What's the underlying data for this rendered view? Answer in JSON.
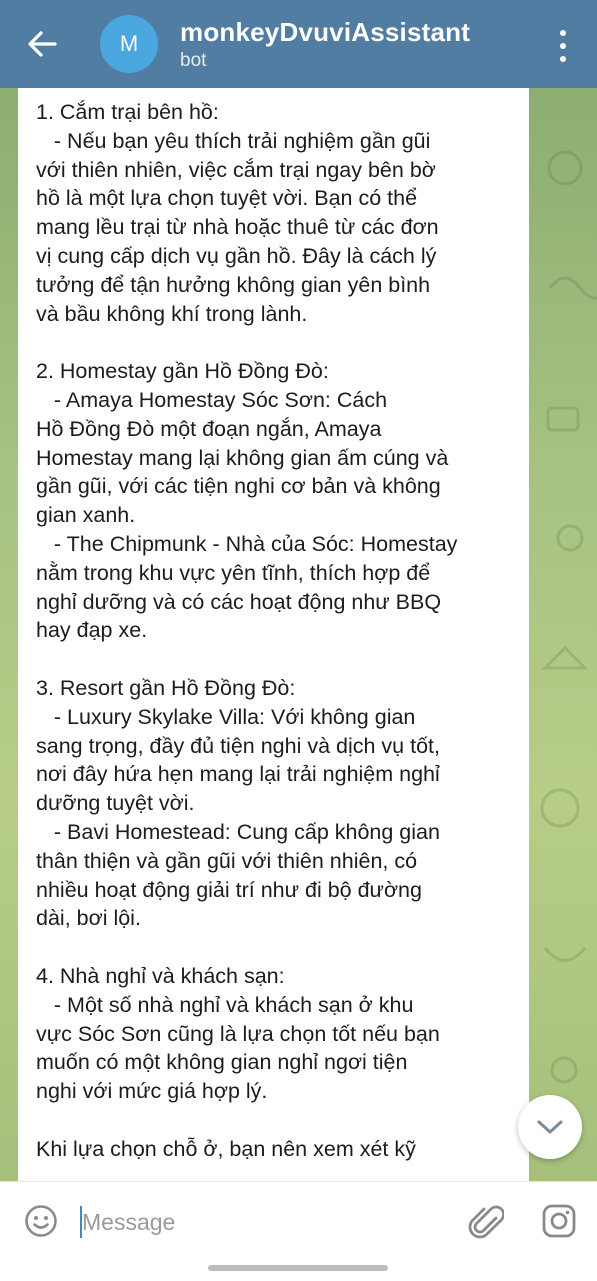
{
  "header": {
    "avatar_letter": "M",
    "title": "monkeyDvuviAssistant",
    "subtitle": "bot"
  },
  "message": {
    "text": "1. Cắm trại bên hồ:\n   - Nếu bạn yêu thích trải nghiệm gần gũi\nvới thiên nhiên, việc cắm trại ngay bên bờ\nhồ là một lựa chọn tuyệt vời. Bạn có thể\nmang lều trại từ nhà hoặc thuê từ các đơn\nvị cung cấp dịch vụ gần hồ. Đây là cách lý\ntưởng để tận hưởng không gian yên bình\nvà bầu không khí trong lành.\n\n2. Homestay gần Hồ Đồng Đò:\n   - Amaya Homestay Sóc Sơn: Cách\nHồ Đồng Đò một đoạn ngắn, Amaya\nHomestay mang lại không gian ấm cúng và\ngần gũi, với các tiện nghi cơ bản và không\ngian xanh.\n   - The Chipmunk - Nhà của Sóc: Homestay\nnằm trong khu vực yên tĩnh, thích hợp để\nnghỉ dưỡng và có các hoạt động như BBQ\nhay đạp xe.\n\n3. Resort gần Hồ Đồng Đò:\n   - Luxury Skylake Villa: Với không gian\nsang trọng, đầy đủ tiện nghi và dịch vụ tốt,\nnơi đây hứa hẹn mang lại trải nghiệm nghỉ\ndưỡng tuyệt vời.\n   - Bavi Homestead: Cung cấp không gian\nthân thiện và gần gũi với thiên nhiên, có\nnhiều hoạt động giải trí như đi bộ đường\ndài, bơi lội.\n\n4. Nhà nghỉ và khách sạn:\n   - Một số nhà nghỉ và khách sạn ở khu\nvực Sóc Sơn cũng là lựa chọn tốt nếu bạn\nmuốn có một không gian nghỉ ngơi tiện\nnghi với mức giá hợp lý.\n\nKhi lựa chọn chỗ ở, bạn nên xem xét kỹ"
  },
  "input": {
    "placeholder": "Message"
  },
  "icons": {
    "back": "arrow-left-icon",
    "menu": "vertical-dots-icon",
    "scroll_down": "chevron-down-icon",
    "emoji": "smiley-icon",
    "attach": "paperclip-icon",
    "camera": "instagram-camera-icon"
  },
  "colors": {
    "header": "#517da2",
    "avatar": "#4aa7e0",
    "bubble": "#ffffff",
    "accent": "#3d89c6"
  }
}
